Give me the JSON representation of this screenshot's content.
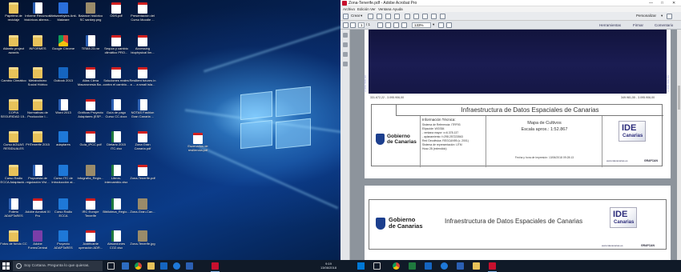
{
  "desktop": {
    "icons": [
      {
        "label": "Papelera de reciclaje",
        "glyph": "g-folder",
        "icon": "recycle-bin-icon"
      },
      {
        "label": "Informe Recursos históricos alterna...",
        "glyph": "g-doc",
        "icon": "word-doc-icon"
      },
      {
        "label": "Malwarebytes Anti-Malware",
        "glyph": "g-mbam",
        "icon": "malwarebytes-icon"
      },
      {
        "label": "Balance histórico SC sankey.png",
        "glyph": "g-img",
        "icon": "image-file-icon"
      },
      {
        "label": "ODS.pdf",
        "glyph": "g-pdf",
        "icon": "pdf-file-icon"
      },
      {
        "label": "Presentación del Curso Moodle ...",
        "glyph": "g-pdf",
        "icon": "pdf-file-icon"
      },
      {
        "label": "Atlantic project awards",
        "glyph": "g-folder",
        "icon": "folder-icon"
      },
      {
        "label": "INFORMES",
        "glyph": "g-folder",
        "icon": "folder-icon"
      },
      {
        "label": "Google Chrome",
        "glyph": "g-chrome",
        "icon": "chrome-icon"
      },
      {
        "label": "TEMA 23.rar",
        "glyph": "g-doc",
        "icon": "archive-file-icon"
      },
      {
        "label": "Sequía y cambio climático PRO...",
        "glyph": "g-pdf",
        "icon": "pdf-file-icon"
      },
      {
        "label": "Accessing biophysical lim...",
        "glyph": "g-pdf",
        "icon": "pdf-file-icon"
      },
      {
        "label": "Cambio Climático",
        "glyph": "g-folder",
        "icon": "folder-icon"
      },
      {
        "label": "Metabolismo Social Hídrico",
        "glyph": "g-folder",
        "icon": "folder-icon"
      },
      {
        "label": "Outlook 2013",
        "glyph": "g-outlook",
        "icon": "outlook-icon"
      },
      {
        "label": "Atlas Clima Macaronesia Ba...",
        "glyph": "g-pdf",
        "icon": "pdf-file-icon"
      },
      {
        "label": "Soluciones reales contra el cambio...",
        "glyph": "g-pdf",
        "icon": "pdf-file-icon"
      },
      {
        "label": "Resilient futures in a ... a small isla...",
        "glyph": "g-pdf",
        "icon": "pdf-file-icon"
      },
      {
        "label": "COPIA SEGURIDAD 15...",
        "glyph": "g-folder",
        "icon": "folder-icon"
      },
      {
        "label": "Normativas de Producción I...",
        "glyph": "g-folder",
        "icon": "folder-icon"
      },
      {
        "label": "Word 2013",
        "glyph": "g-doc",
        "icon": "word-icon"
      },
      {
        "label": "Gráficos Proyecto Adaptares (ESP...",
        "glyph": "g-pdf",
        "icon": "pdf-file-icon"
      },
      {
        "label": "Guía de pago Curso CC.docx",
        "glyph": "g-doc",
        "icon": "word-doc-icon"
      },
      {
        "label": "NOTAS Fashion Gran Canaria ...",
        "glyph": "g-doc",
        "icon": "word-doc-icon"
      },
      {
        "label": "Curso AGUAS RESIDUALES",
        "glyph": "g-folder",
        "icon": "folder-icon"
      },
      {
        "label": "PHTenerife 2015",
        "glyph": "g-folder",
        "icon": "folder-icon"
      },
      {
        "label": "adaptares",
        "glyph": "g-ie",
        "icon": "internet-explorer-icon"
      },
      {
        "label": "Guía_IPCC.pdf",
        "glyph": "g-pdf",
        "icon": "pdf-file-icon"
      },
      {
        "label": "Dietario 2015 ITC.xlsx",
        "glyph": "g-xls",
        "icon": "excel-file-icon"
      },
      {
        "label": "Zona Gran Canaria.pdf",
        "glyph": "g-pdf",
        "icon": "pdf-file-icon"
      },
      {
        "label": "Curso Radio ECCA Adaptació...",
        "glyph": "g-folder",
        "icon": "folder-icon"
      },
      {
        "label": "Propuesta de regulación Vivi...",
        "glyph": "g-doc",
        "icon": "word-doc-icon"
      },
      {
        "label": "Curso ITC de Introducción al...",
        "glyph": "g-ie",
        "icon": "internet-explorer-icon"
      },
      {
        "label": "Infografía_Regio...",
        "glyph": "g-img",
        "icon": "image-file-icon"
      },
      {
        "label": "Libros-intercambio.xlsx",
        "glyph": "g-xls",
        "icon": "excel-file-icon"
      },
      {
        "label": "Zona-Tenerife.pdf",
        "glyph": "g-pdf",
        "icon": "pdf-file-icon"
      },
      {
        "label": "Folleto ADAPTaRES",
        "glyph": "g-doc",
        "icon": "word-doc-icon"
      },
      {
        "label": "Adobe Acrobat XI Pro",
        "glyph": "g-pdf",
        "icon": "acrobat-icon"
      },
      {
        "label": "Curso Radio ECCA",
        "glyph": "g-ie",
        "icon": "internet-explorer-icon"
      },
      {
        "label": "IRC Europe Tenerife",
        "glyph": "g-pdf",
        "icon": "pdf-file-icon"
      },
      {
        "label": "Biblioteca_Regio...",
        "glyph": "g-xls",
        "icon": "excel-file-icon"
      },
      {
        "label": "Zona-Gran-Can...",
        "glyph": "g-img",
        "icon": "image-file-icon"
      },
      {
        "label": "Fotos de fondo CC",
        "glyph": "g-folder",
        "icon": "folder-icon"
      },
      {
        "label": "Adobe FormsCentral",
        "glyph": "g-app",
        "icon": "formscentral-icon"
      },
      {
        "label": "Proyecto ADAPTaRES",
        "glyph": "g-ie",
        "icon": "internet-explorer-icon"
      },
      {
        "label": "Justificante operación ADR...",
        "glyph": "g-pdf",
        "icon": "pdf-file-icon"
      },
      {
        "label": "Absorciones CO2.xlsx",
        "glyph": "g-xls",
        "icon": "excel-file-icon"
      },
      {
        "label": "Zona-Tenerife.jpg",
        "glyph": "g-img",
        "icon": "image-file-icon"
      }
    ],
    "dragged": {
      "label": "Escenarios de resiliencia.pdf"
    }
  },
  "acrobat": {
    "title": "Zona-Tenerife.pdf - Adobe Acrobat Pro",
    "menu": [
      "Archivo",
      "Edición",
      "Ver",
      "Ventana",
      "Ayuda"
    ],
    "create_label": "Crear",
    "customize_label": "Personalizar",
    "page_current": "1",
    "page_total": "/ 1",
    "zoom": "133%",
    "tabs": [
      "Herramientas",
      "Firmar",
      "Comentario"
    ],
    "page1": {
      "coord_left": "331.672,22 - 3.095.906,00",
      "coord_right": "349.981,55 - 3.095.906,00",
      "vcoord_left": "3.095.906,00",
      "vcoord_right": "3.095.906,00",
      "header": "Infraestructura de Datos Espaciales de Canarias",
      "info_title": "Información Técnica:",
      "info_lines": [
        "Sistema de Referencia: ITRF93",
        "Elipsoide: WGS84",
        "- ventana mayor: x=6.378.137",
        "- aplanamiento: f=298.257223563",
        "Red Geodésica: REGCAN95 (c. 2001)",
        "Sistema de representación: UTM",
        "Huso 28 (extendido)"
      ],
      "map_title": "Mapa de Cultivos",
      "scale": "Escala aprox.: 1:52.867",
      "print_date": "Fecha y hora de impresión:  13/06/2018 09:28:13",
      "gob_line1": "Gobierno",
      "gob_line2": "de Canarias",
      "ide_big": "IDE",
      "ide_small": "Canarias",
      "ide_url": "www.idecanarias.es",
      "grafcan": "GRAFCAN"
    },
    "page2": {
      "header": "Infraestructura de Datos Espaciales de Canarias",
      "gob_line1": "Gobierno",
      "gob_line2": "de Canarias",
      "ide_big": "IDE",
      "ide_small": "Canarias",
      "ide_url": "www.idecanarias.es",
      "grafcan": "GRAFCAN"
    }
  },
  "taskbar": {
    "search_placeholder": "Soy Cortana. Pregunta lo que quieras.",
    "time": "9:19",
    "date": "13/06/2018"
  }
}
